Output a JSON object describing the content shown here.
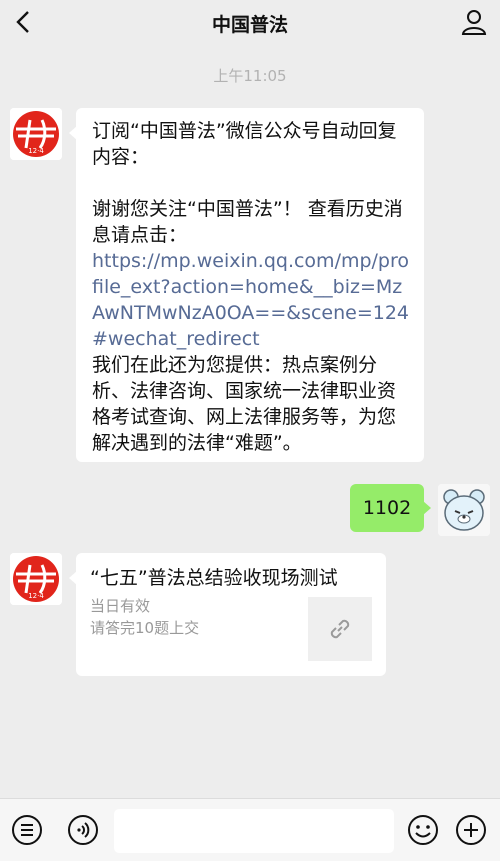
{
  "header": {
    "title": "中国普法"
  },
  "chat": {
    "timestamp": "上午11:05",
    "messages": [
      {
        "sender": "中国普法",
        "lines_top": "订阅“中国普法”微信公众号自动回复内容：",
        "lines_mid": "谢谢您关注“中国普法”！ 查看历史消息请点击：",
        "link": "https://mp.weixin.qq.com/mp/profile_ext?action=home&__biz=MzAwNTMwNzA0OA==&scene=124#wechat_redirect",
        "lines_bottom": " 我们在此还为您提供：热点案例分析、法律咨询、国家统一法律职业资格考试查询、网上法律服务等，为您解决遇到的法律“难题”。"
      },
      {
        "sender": "me",
        "text": "1102"
      },
      {
        "sender": "中国普法",
        "card_title": "“七五”普法总结验收现场测试",
        "card_line1": "当日有效",
        "card_line2": "请答完10题上交"
      }
    ]
  },
  "avatars": {
    "official_logo_text": "12·4"
  },
  "input": {
    "placeholder": ""
  },
  "colors": {
    "background": "#ededed",
    "sent_bubble": "#95ec69",
    "link": "#576b95",
    "logo_red": "#e1251b"
  },
  "icons": [
    "back-icon",
    "profile-icon",
    "menu-icon",
    "voice-icon",
    "emoji-icon",
    "plus-icon",
    "link-icon"
  ]
}
